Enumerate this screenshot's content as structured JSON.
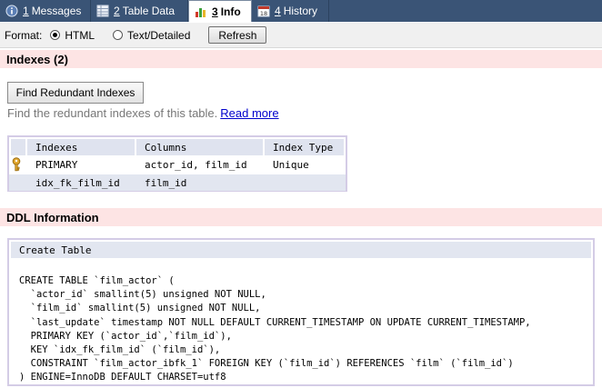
{
  "tabs": [
    {
      "num": "1",
      "label": "Messages",
      "icon": "info-icon"
    },
    {
      "num": "2",
      "label": "Table Data",
      "icon": "table-icon"
    },
    {
      "num": "3",
      "label": "Info",
      "icon": "info-chart-icon",
      "active": true
    },
    {
      "num": "4",
      "label": "History",
      "icon": "calendar-icon"
    }
  ],
  "format": {
    "label": "Format:",
    "options": [
      "HTML",
      "Text/Detailed"
    ],
    "selected": "HTML",
    "refresh_label": "Refresh"
  },
  "indexes": {
    "header": "Indexes (2)",
    "find_button": "Find Redundant Indexes",
    "find_desc": "Find the redundant indexes of this table.",
    "read_more": "Read more",
    "columns": [
      "Indexes",
      "Columns",
      "Index Type"
    ],
    "rows": [
      {
        "name": "PRIMARY",
        "columns": "actor_id, film_id",
        "type": "Unique",
        "icon": "key-icon"
      },
      {
        "name": "idx_fk_film_id",
        "columns": "film_id",
        "type": "",
        "icon": ""
      }
    ]
  },
  "ddl": {
    "header": "DDL Information",
    "box_title": "Create Table",
    "code": "CREATE TABLE `film_actor` (\n  `actor_id` smallint(5) unsigned NOT NULL,\n  `film_id` smallint(5) unsigned NOT NULL,\n  `last_update` timestamp NOT NULL DEFAULT CURRENT_TIMESTAMP ON UPDATE CURRENT_TIMESTAMP,\n  PRIMARY KEY (`actor_id`,`film_id`),\n  KEY `idx_fk_film_id` (`film_id`),\n  CONSTRAINT `film_actor_ibfk_1` FOREIGN KEY (`film_id`) REFERENCES `film` (`film_id`)\n) ENGINE=InnoDB DEFAULT CHARSET=utf8"
  },
  "colors": {
    "tabbar_bg": "#3a5476",
    "section_bg": "#fde4e4",
    "link": "#0000cc",
    "table_border": "#d4cce6"
  }
}
